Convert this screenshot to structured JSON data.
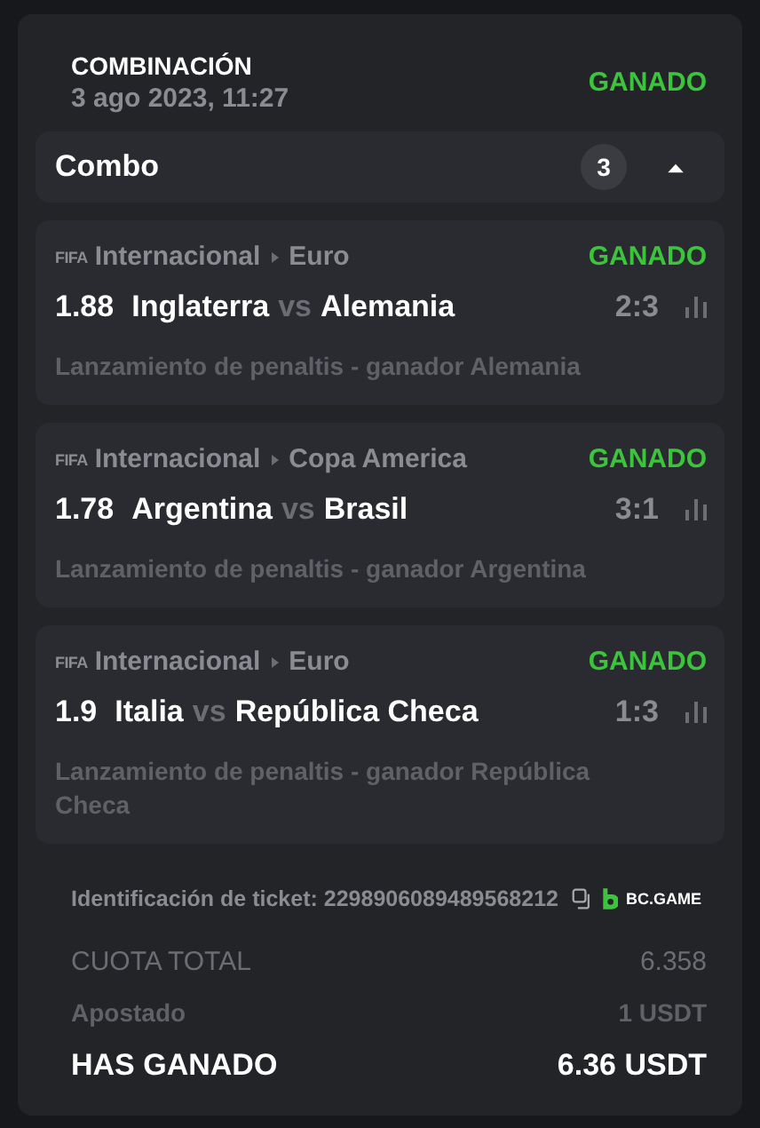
{
  "bet": {
    "type_label": "COMBINACIÓN",
    "date": "3 ago 2023, 11:27",
    "status": "GANADO",
    "kind": "won"
  },
  "combo": {
    "label": "Combo",
    "count": "3",
    "expanded": true
  },
  "selections": [
    {
      "logo": "FIFA",
      "category": "Internacional",
      "league": "Euro",
      "status": "GANADO",
      "kind": "won",
      "odds": "1.88",
      "home": "Inglaterra",
      "vs": "vs",
      "away": "Alemania",
      "score": "2:3",
      "market": "Lanzamiento de penaltis - ganador Alemania"
    },
    {
      "logo": "FIFA",
      "category": "Internacional",
      "league": "Copa America",
      "status": "GANADO",
      "kind": "won",
      "odds": "1.78",
      "home": "Argentina",
      "vs": "vs",
      "away": "Brasil",
      "score": "3:1",
      "market": "Lanzamiento de penaltis - ganador Argentina"
    },
    {
      "logo": "FIFA",
      "category": "Internacional",
      "league": "Euro",
      "status": "GANADO",
      "kind": "won",
      "odds": "1.9",
      "home": "Italia",
      "vs": "vs",
      "away": "República Checa",
      "score": "1:3",
      "market": "Lanzamiento de penaltis - ganador República Checa"
    }
  ],
  "ticket": {
    "label": "Identificación de ticket: 2298906089489568212",
    "brand": "BC.GAME"
  },
  "summary": [
    {
      "kind": "muted",
      "label": "CUOTA TOTAL",
      "value": "6.358"
    },
    {
      "kind": "bold-muted",
      "label": "Apostado",
      "value": "1 USDT"
    },
    {
      "kind": "total",
      "label": "HAS GANADO",
      "value": "6.36 USDT"
    }
  ]
}
